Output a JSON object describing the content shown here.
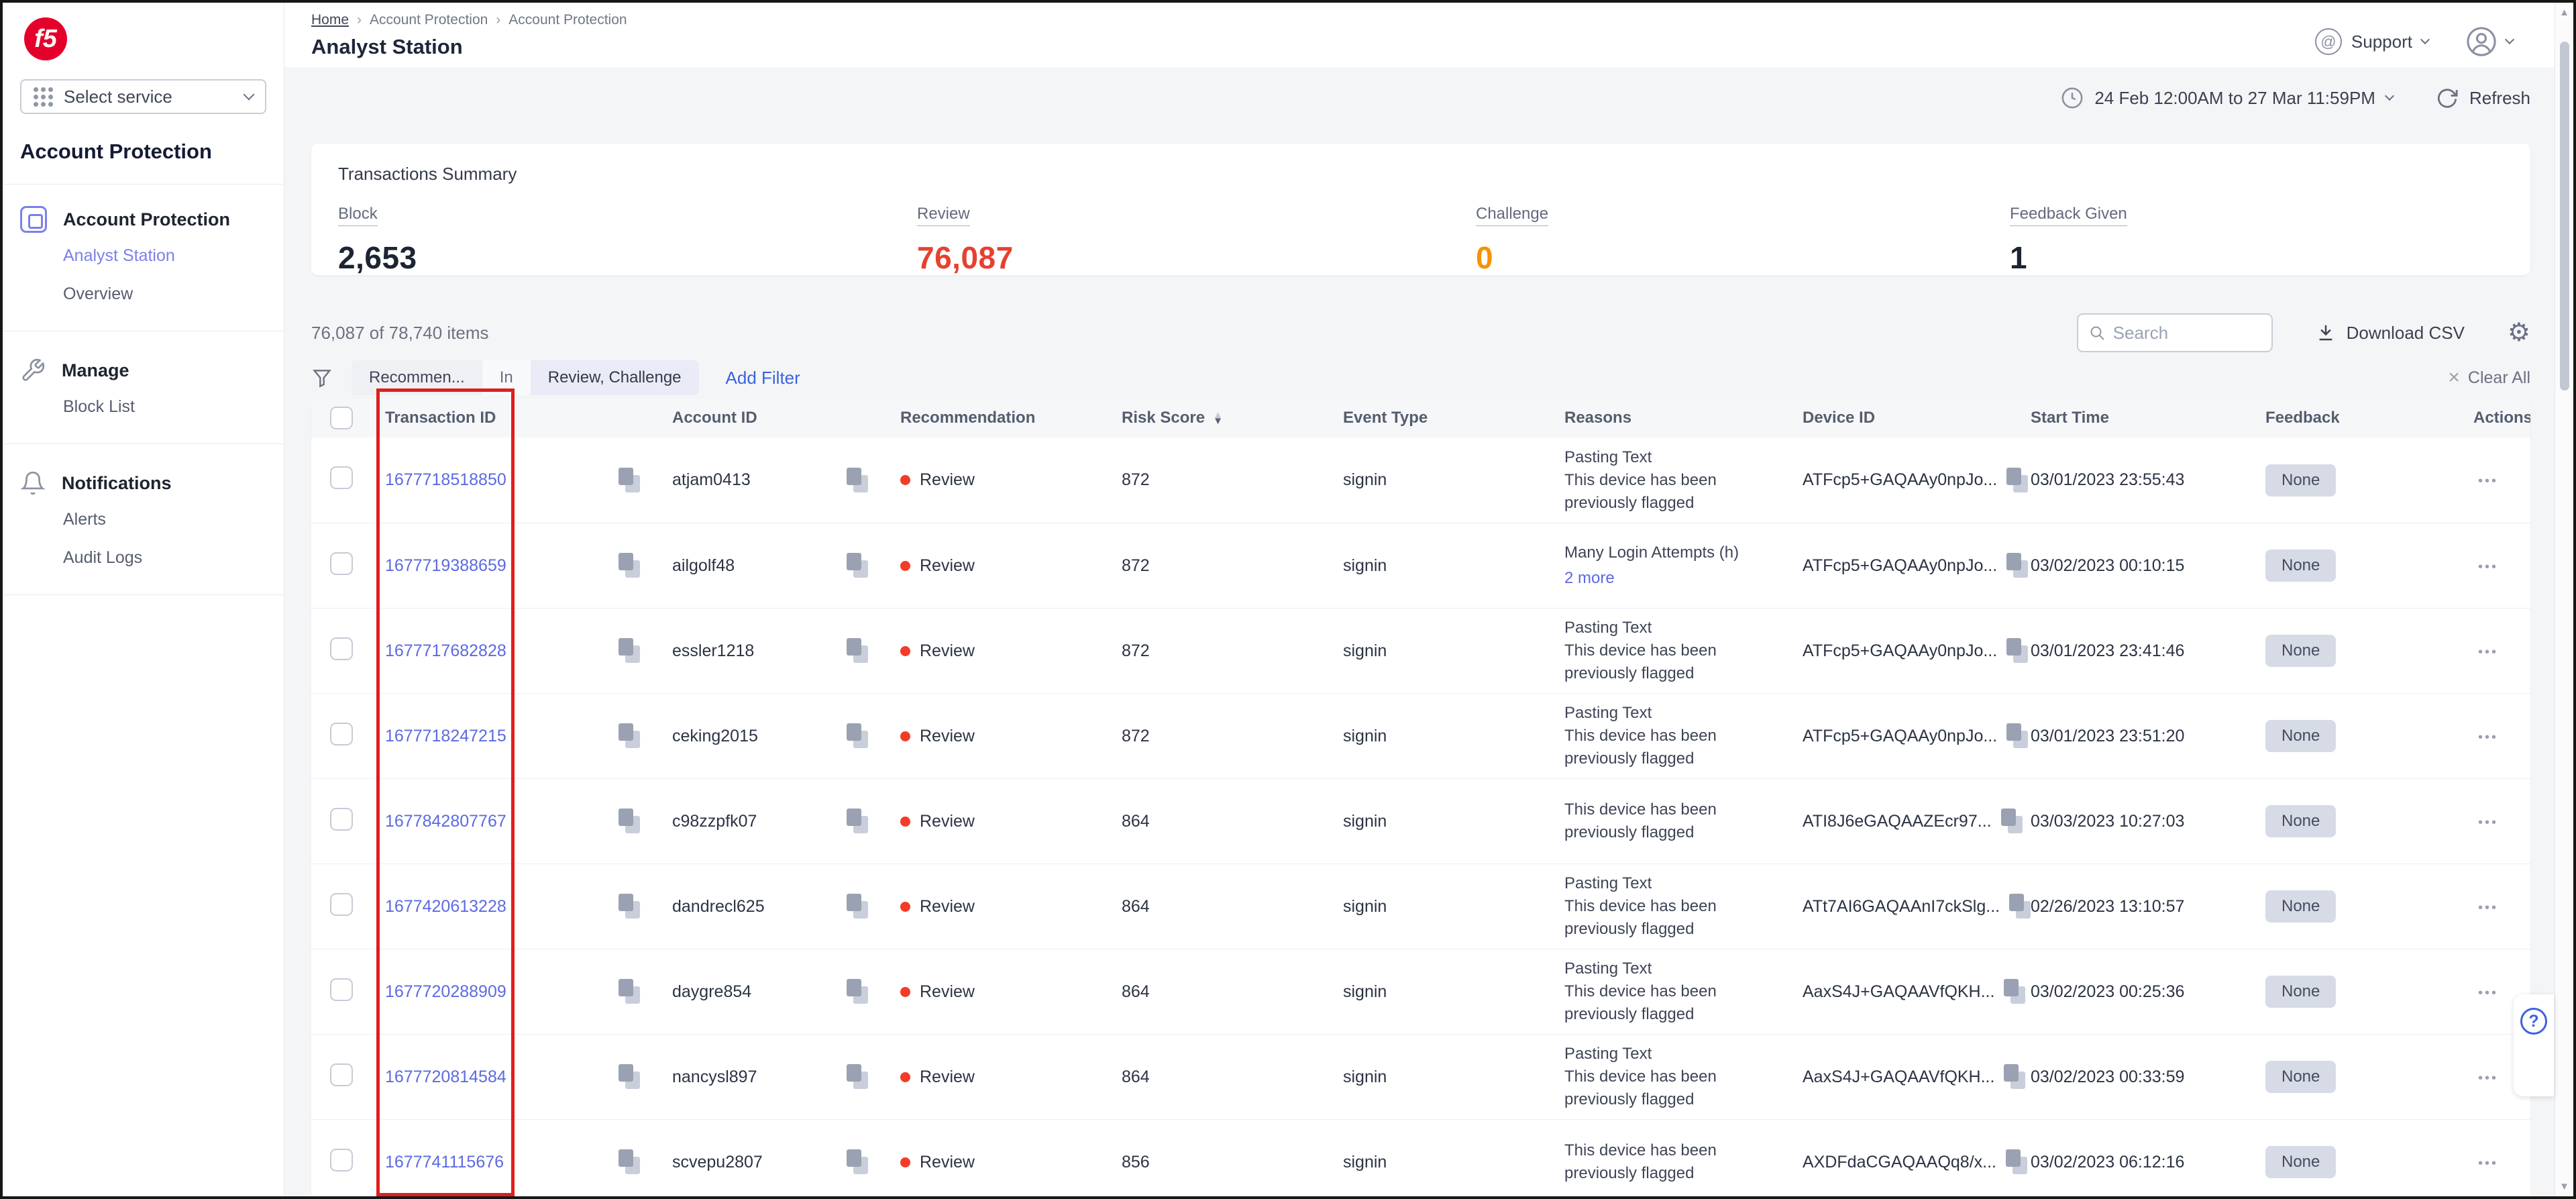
{
  "brand": {
    "logo_text": "f5"
  },
  "sidebar": {
    "service_selector": "Select service",
    "product_title": "Account Protection",
    "sections": [
      {
        "icon": "shield-app-icon",
        "label": "Account Protection",
        "items": [
          {
            "label": "Analyst Station",
            "active": true
          },
          {
            "label": "Overview",
            "active": false
          }
        ]
      },
      {
        "icon": "wrench-icon",
        "label": "Manage",
        "items": [
          {
            "label": "Block List",
            "active": false
          }
        ]
      },
      {
        "icon": "bell-icon",
        "label": "Notifications",
        "items": [
          {
            "label": "Alerts",
            "active": false
          },
          {
            "label": "Audit Logs",
            "active": false
          }
        ]
      }
    ]
  },
  "header": {
    "breadcrumb": [
      "Home",
      "Account Protection",
      "Account Protection"
    ],
    "page_title": "Analyst Station",
    "support_label": "Support"
  },
  "toolbar": {
    "date_range": "24 Feb 12:00AM to 27 Mar 11:59PM",
    "refresh_label": "Refresh"
  },
  "summary": {
    "title": "Transactions Summary",
    "stats": [
      {
        "label": "Block",
        "value": "2,653",
        "color": "#1d2433"
      },
      {
        "label": "Review",
        "value": "76,087",
        "color": "#e8402e"
      },
      {
        "label": "Challenge",
        "value": "0",
        "color": "#f59300"
      },
      {
        "label": "Feedback Given",
        "value": "1",
        "color": "#1d2433"
      }
    ]
  },
  "table_toolbar": {
    "items_count": "76,087 of 78,740 items",
    "search_placeholder": "Search",
    "download_label": "Download CSV",
    "filter": {
      "field": "Recommen...",
      "operator": "In",
      "value": "Review, Challenge",
      "add_label": "Add Filter",
      "clear_label": "Clear All"
    }
  },
  "table": {
    "columns": [
      "Transaction ID",
      "Account ID",
      "Recommendation",
      "Risk Score",
      "Event Type",
      "Reasons",
      "Device ID",
      "Start Time",
      "Feedback",
      "Actions"
    ],
    "sorted_column": "Risk Score",
    "rows": [
      {
        "transaction_id": "1677718518850",
        "account_id": "atjam0413",
        "recommendation": "Review",
        "risk_score": "872",
        "event_type": "signin",
        "reasons": [
          "Pasting Text",
          "This device has been previously flagged"
        ],
        "reasons_more": "",
        "device_id": "ATFcp5+GAQAAy0npJo...",
        "start_time": "03/01/2023 23:55:43",
        "feedback": "None"
      },
      {
        "transaction_id": "1677719388659",
        "account_id": "ailgolf48",
        "recommendation": "Review",
        "risk_score": "872",
        "event_type": "signin",
        "reasons": [
          "Many Login Attempts (h)"
        ],
        "reasons_more": "2 more",
        "device_id": "ATFcp5+GAQAAy0npJo...",
        "start_time": "03/02/2023 00:10:15",
        "feedback": "None"
      },
      {
        "transaction_id": "1677717682828",
        "account_id": "essler1218",
        "recommendation": "Review",
        "risk_score": "872",
        "event_type": "signin",
        "reasons": [
          "Pasting Text",
          "This device has been previously flagged"
        ],
        "reasons_more": "",
        "device_id": "ATFcp5+GAQAAy0npJo...",
        "start_time": "03/01/2023 23:41:46",
        "feedback": "None"
      },
      {
        "transaction_id": "1677718247215",
        "account_id": "ceking2015",
        "recommendation": "Review",
        "risk_score": "872",
        "event_type": "signin",
        "reasons": [
          "Pasting Text",
          "This device has been previously flagged"
        ],
        "reasons_more": "",
        "device_id": "ATFcp5+GAQAAy0npJo...",
        "start_time": "03/01/2023 23:51:20",
        "feedback": "None"
      },
      {
        "transaction_id": "1677842807767",
        "account_id": "c98zzpfk07",
        "recommendation": "Review",
        "risk_score": "864",
        "event_type": "signin",
        "reasons": [
          "This device has been previously flagged"
        ],
        "reasons_more": "",
        "device_id": "ATI8J6eGAQAAZEcr97...",
        "start_time": "03/03/2023 10:27:03",
        "feedback": "None"
      },
      {
        "transaction_id": "1677420613228",
        "account_id": "dandrecl625",
        "recommendation": "Review",
        "risk_score": "864",
        "event_type": "signin",
        "reasons": [
          "Pasting Text",
          "This device has been previously flagged"
        ],
        "reasons_more": "",
        "device_id": "ATt7AI6GAQAAnI7ckSlg...",
        "start_time": "02/26/2023 13:10:57",
        "feedback": "None"
      },
      {
        "transaction_id": "1677720288909",
        "account_id": "daygre854",
        "recommendation": "Review",
        "risk_score": "864",
        "event_type": "signin",
        "reasons": [
          "Pasting Text",
          "This device has been previously flagged"
        ],
        "reasons_more": "",
        "device_id": "AaxS4J+GAQAAVfQKH...",
        "start_time": "03/02/2023 00:25:36",
        "feedback": "None"
      },
      {
        "transaction_id": "1677720814584",
        "account_id": "nancysl897",
        "recommendation": "Review",
        "risk_score": "864",
        "event_type": "signin",
        "reasons": [
          "Pasting Text",
          "This device has been previously flagged"
        ],
        "reasons_more": "",
        "device_id": "AaxS4J+GAQAAVfQKH...",
        "start_time": "03/02/2023 00:33:59",
        "feedback": "None"
      },
      {
        "transaction_id": "1677741115676",
        "account_id": "scvepu2807",
        "recommendation": "Review",
        "risk_score": "856",
        "event_type": "signin",
        "reasons": [
          "This device has been previously flagged"
        ],
        "reasons_more": "",
        "device_id": "AXDFdaCGAQAAQq8/x...",
        "start_time": "03/02/2023 06:12:16",
        "feedback": "None"
      }
    ]
  },
  "annotation": {
    "type": "highlight-box",
    "column": "Transaction ID",
    "color": "#dd1f1f"
  },
  "icons": {
    "gear_glyph": "⚙",
    "more_glyph": "•••",
    "help_glyph": "?",
    "clear_glyph": "×",
    "at_glyph": "@",
    "breadcrumb_sep": "›",
    "sort_up": "▲",
    "sort_down": "▼",
    "scroll_up": "▲",
    "scroll_down": "▼"
  },
  "colors": {
    "f5_red": "#e4002b",
    "active_purple": "#7b80ea",
    "link_blue": "#3b63e0",
    "txn_link_blue": "#5c6ae0",
    "review_red": "#e8402e",
    "challenge_orange": "#f59300",
    "annotation_red": "#dd1f1f"
  }
}
